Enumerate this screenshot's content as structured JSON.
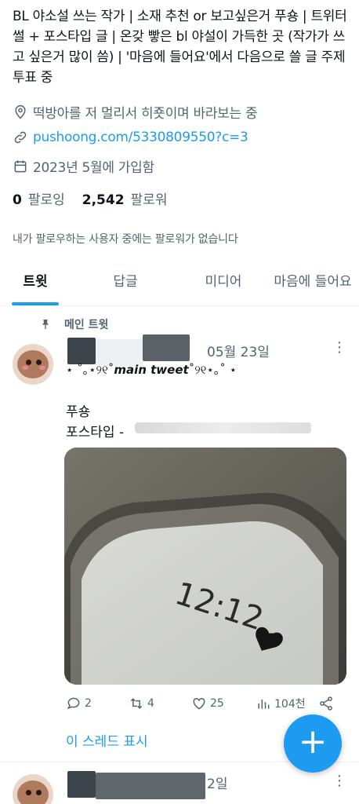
{
  "profile": {
    "bio": "BL 야소설 쓰는 작가 | 소재 추천 or 보고싶은거 푸숑 | 트위터 썰 + 포스타입 글 | 온갖 빻은 bl 야설이 가득한 곳 (작가가 쓰고 싶은거 많이 씀) | '마음에 들어요'에서 다음으로 쓸 글 주제 투표 중",
    "location": "떡방아를 저 멀리서 히죳이며 바라보는 중",
    "link": "pushoong.com/5330809550?c=3",
    "joined": "2023년 5월에 가입함",
    "following_count": "0",
    "following_label": "팔로잉",
    "followers_count": "2,542",
    "followers_label": "팔로워",
    "notice": "내가 팔로우하는 사용자 중에는 팔로워가 없습니다"
  },
  "tabs": [
    {
      "label": "트윗"
    },
    {
      "label": "답글"
    },
    {
      "label": "미디어"
    },
    {
      "label": "마음에 들어요"
    }
  ],
  "tweet": {
    "pinned_label": "메인 트윗",
    "date": "05월 23일",
    "handle_prefix": "⋆ ˚｡⋆୨୧˚",
    "handle_main": "main tweet",
    "handle_suffix": "˚୨୧⋆｡˚ ⋆",
    "text_line1": "푸숑",
    "text_line2": "포스타입 -",
    "photo_time": "12:12",
    "replies": "2",
    "retweets": "4",
    "likes": "25",
    "views": "104천",
    "thread_label": "이 스레드 표시"
  },
  "next_tweet": {
    "date_partial": "2일"
  },
  "fab": {
    "symbol": "+"
  },
  "colors": {
    "accent": "#1d9bf0",
    "muted": "#536471",
    "text": "#0f1419"
  }
}
